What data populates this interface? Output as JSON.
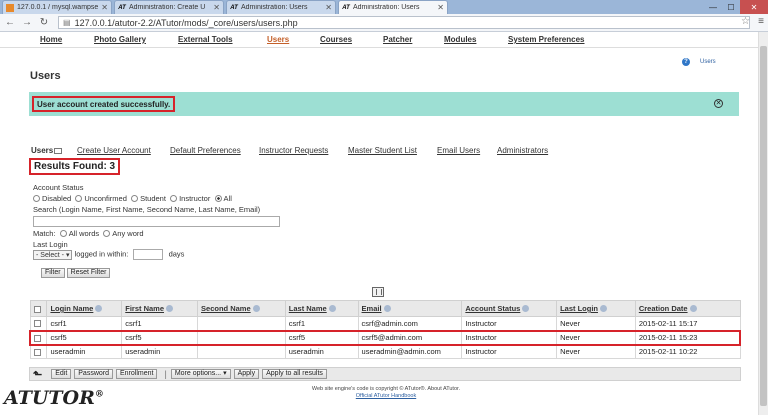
{
  "browser": {
    "tabs": [
      {
        "title": "127.0.0.1 / mysql.wampse",
        "fav": "mysql",
        "active": false
      },
      {
        "title": "Administration: Create U",
        "fav": "AT",
        "active": false
      },
      {
        "title": "Administration: Users",
        "fav": "AT",
        "active": false
      },
      {
        "title": "Administration: Users",
        "fav": "AT",
        "active": true
      }
    ],
    "url": "127.0.0.1/atutor-2.2/ATutor/mods/_core/users/users.php"
  },
  "topnav": [
    "Home",
    "Photo Gallery",
    "External Tools",
    "Users",
    "Courses",
    "Patcher",
    "Modules",
    "System Preferences"
  ],
  "help_label": "Users",
  "page_title": "Users",
  "feedback": "User account created successfully.",
  "subnav": {
    "current": "Users",
    "links": [
      "Create User Account",
      "Default Preferences",
      "Instructor Requests",
      "Master Student List",
      "Email Users",
      "Administrators"
    ]
  },
  "results_found": "Results Found: 3",
  "filter": {
    "account_status_label": "Account Status",
    "status_options": [
      "Disabled",
      "Unconfirmed",
      "Student",
      "Instructor",
      "All"
    ],
    "search_label": "Search (Login Name, First Name, Second Name, Last Name, Email)",
    "match_label": "Match:",
    "match_options": [
      "All words",
      "Any word"
    ],
    "last_login_label": "Last Login",
    "select_label": "- Select -",
    "logged_in_within": "logged in within:",
    "days": "days",
    "filter_btn": "Filter",
    "reset_btn": "Reset Filter"
  },
  "table": {
    "headers": [
      "Login Name",
      "First Name",
      "Second Name",
      "Last Name",
      "Email",
      "Account Status",
      "Last Login",
      "Creation Date"
    ],
    "rows": [
      [
        "csrf1",
        "csrf1",
        "",
        "csrf1",
        "csrf@admin.com",
        "Instructor",
        "Never",
        "2015-02-11 15:17"
      ],
      [
        "csrf5",
        "csrf5",
        "",
        "csrf5",
        "csrf5@admin.com",
        "Instructor",
        "Never",
        "2015-02-11 15:23"
      ],
      [
        "useradmin",
        "useradmin",
        "",
        "useradmin",
        "useradmin@admin.com",
        "Instructor",
        "Never",
        "2015-02-11 10:22"
      ]
    ]
  },
  "actions": {
    "edit": "Edit",
    "password": "Password",
    "enrollment": "Enrollment",
    "separator": "|",
    "more": "More options...",
    "apply": "Apply",
    "apply_all": "Apply to all results"
  },
  "footer": {
    "line1": "Web site engine's code is copyright © ATutor®. About ATutor.",
    "line2": "Official ATutor Handbook"
  },
  "logo": {
    "text": "ATUTOR",
    "mark": "®"
  },
  "colors": {
    "accent": "#c4602a",
    "feedback_bg": "#9ddfd3",
    "highlight": "#d6232a"
  }
}
